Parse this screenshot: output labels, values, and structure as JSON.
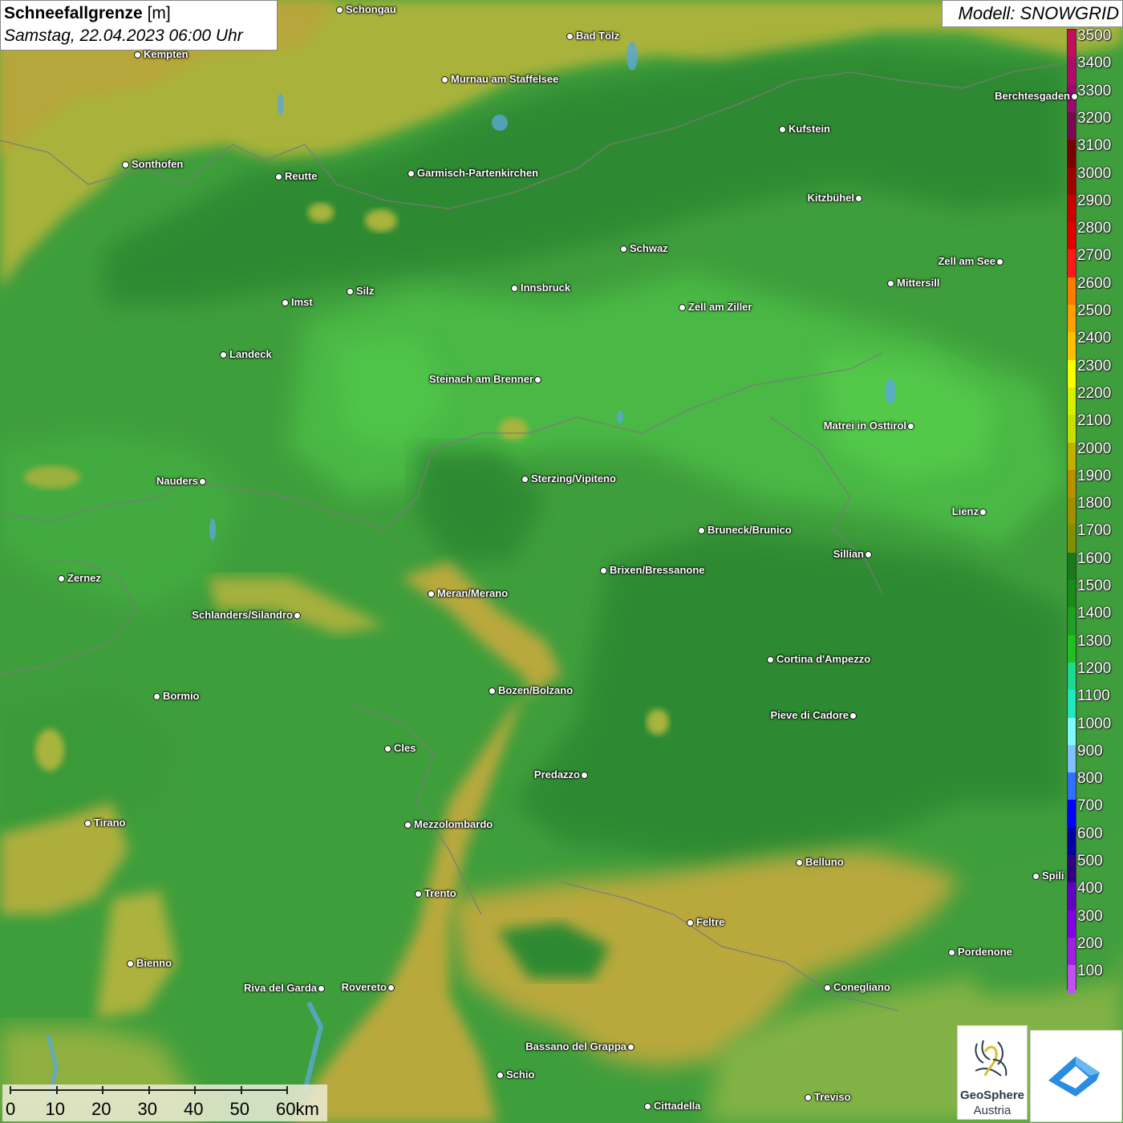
{
  "title": {
    "main": "Schneefallgrenze",
    "unit": "[m]",
    "datetime": "Samstag, 22.04.2023 06:00 Uhr"
  },
  "model": "Modell: SNOWGRID",
  "legend": {
    "levels": [
      "3500",
      "3400",
      "3300",
      "3200",
      "3100",
      "3000",
      "2900",
      "2800",
      "2700",
      "2600",
      "2500",
      "2400",
      "2300",
      "2200",
      "2100",
      "2000",
      "1900",
      "1800",
      "1700",
      "1600",
      "1500",
      "1400",
      "1300",
      "1200",
      "1100",
      "1000",
      "900",
      "800",
      "700",
      "600",
      "500",
      "400",
      "300",
      "200",
      "100"
    ],
    "colors": [
      "#c0105a",
      "#b00a6a",
      "#9a0870",
      "#7a0a50",
      "#7a0000",
      "#a00000",
      "#c80000",
      "#e00000",
      "#ff1a1a",
      "#ff7a00",
      "#ffa000",
      "#ffc000",
      "#ffff00",
      "#d8f000",
      "#c8e000",
      "#c0b000",
      "#b89000",
      "#a09000",
      "#809000",
      "#1a7a1a",
      "#1a8a1a",
      "#20a020",
      "#20c020",
      "#20d890",
      "#20e8c0",
      "#80f8ff",
      "#80c0ff",
      "#3070ff",
      "#0000ff",
      "#0000a0",
      "#300080",
      "#6000c0",
      "#8000e0",
      "#a020e0",
      "#c050f0"
    ]
  },
  "cities": [
    {
      "name": "Schongau",
      "label_side": "right"
    },
    {
      "name": "Bad Tölz",
      "label_side": "right"
    },
    {
      "name": "Kempten",
      "label_side": "right"
    },
    {
      "name": "Murnau am Staffelsee",
      "label_side": "right"
    },
    {
      "name": "Berchtesgaden",
      "label_side": "left"
    },
    {
      "name": "Kufstein",
      "label_side": "right"
    },
    {
      "name": "Sonthofen",
      "label_side": "right"
    },
    {
      "name": "Reutte",
      "label_side": "right"
    },
    {
      "name": "Garmisch-Partenkirchen",
      "label_side": "right"
    },
    {
      "name": "Kitzbühel",
      "label_side": "left"
    },
    {
      "name": "Schwaz",
      "label_side": "right"
    },
    {
      "name": "Zell am See",
      "label_side": "left"
    },
    {
      "name": "Innsbruck",
      "label_side": "right"
    },
    {
      "name": "Mittersill",
      "label_side": "right"
    },
    {
      "name": "Imst",
      "label_side": "right"
    },
    {
      "name": "Silz",
      "label_side": "right"
    },
    {
      "name": "Zell am Ziller",
      "label_side": "right"
    },
    {
      "name": "Landeck",
      "label_side": "right"
    },
    {
      "name": "Steinach am Brenner",
      "label_side": "left"
    },
    {
      "name": "Matrei in Osttirol",
      "label_side": "left"
    },
    {
      "name": "Nauders",
      "label_side": "left"
    },
    {
      "name": "Sterzing/Vipiteno",
      "label_side": "right"
    },
    {
      "name": "Lienz",
      "label_side": "left"
    },
    {
      "name": "Bruneck/Brunico",
      "label_side": "right"
    },
    {
      "name": "Sillian",
      "label_side": "left"
    },
    {
      "name": "Zernez",
      "label_side": "right"
    },
    {
      "name": "Brixen/Bressanone",
      "label_side": "right"
    },
    {
      "name": "Meran/Merano",
      "label_side": "right"
    },
    {
      "name": "Schlanders/Silandro",
      "label_side": "left"
    },
    {
      "name": "Cortina d'Ampezzo",
      "label_side": "right"
    },
    {
      "name": "Bozen/Bolzano",
      "label_side": "right"
    },
    {
      "name": "Bormio",
      "label_side": "right"
    },
    {
      "name": "Pieve di Cadore",
      "label_side": "left"
    },
    {
      "name": "Cles",
      "label_side": "right"
    },
    {
      "name": "Predazzo",
      "label_side": "left"
    },
    {
      "name": "Tirano",
      "label_side": "right"
    },
    {
      "name": "Mezzolombardo",
      "label_side": "right"
    },
    {
      "name": "Belluno",
      "label_side": "right"
    },
    {
      "name": "Spili",
      "label_side": "right"
    },
    {
      "name": "Trento",
      "label_side": "right"
    },
    {
      "name": "Feltre",
      "label_side": "right"
    },
    {
      "name": "Pordenone",
      "label_side": "right"
    },
    {
      "name": "Bienno",
      "label_side": "right"
    },
    {
      "name": "Riva del Garda",
      "label_side": "left"
    },
    {
      "name": "Rovereto",
      "label_side": "left"
    },
    {
      "name": "Conegliano",
      "label_side": "right"
    },
    {
      "name": "Bassano del Grappa",
      "label_side": "left"
    },
    {
      "name": "Schio",
      "label_side": "right"
    },
    {
      "name": "Treviso",
      "label_side": "right"
    },
    {
      "name": "Cittadella",
      "label_side": "right"
    }
  ],
  "scalebar": {
    "labels": [
      "0",
      "10",
      "20",
      "30",
      "40",
      "50",
      "60km"
    ]
  },
  "logos": {
    "geosphere_name": "GeoSphere",
    "geosphere_sub": "Austria"
  }
}
